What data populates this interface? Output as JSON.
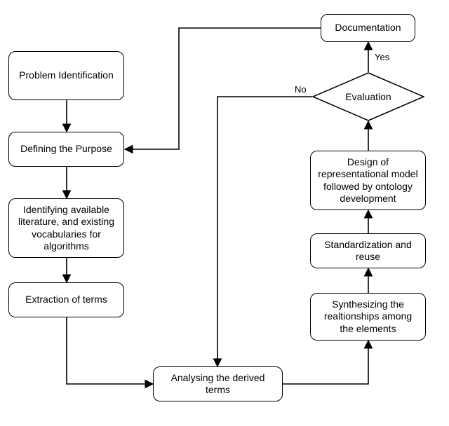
{
  "chart_data": {
    "type": "flowchart",
    "nodes": [
      {
        "id": "problem",
        "label": "Problem Identification",
        "kind": "process"
      },
      {
        "id": "purpose",
        "label": "Defining the Purpose",
        "kind": "process"
      },
      {
        "id": "literature",
        "label": "Identifying available literature, and existing vocabularies for algorithms",
        "kind": "process"
      },
      {
        "id": "extract",
        "label": "Extraction of terms",
        "kind": "process"
      },
      {
        "id": "analyse",
        "label": "Analysing the derived terms",
        "kind": "process"
      },
      {
        "id": "synth",
        "label": "Synthesizing the realtionships among the elements",
        "kind": "process"
      },
      {
        "id": "standard",
        "label": "Standardization and reuse",
        "kind": "process"
      },
      {
        "id": "design",
        "label": "Design of representational model followed by ontology development",
        "kind": "process"
      },
      {
        "id": "eval",
        "label": "Evaluation",
        "kind": "decision"
      },
      {
        "id": "doc",
        "label": "Documentation",
        "kind": "process"
      }
    ],
    "edges": [
      {
        "from": "problem",
        "to": "purpose"
      },
      {
        "from": "purpose",
        "to": "literature"
      },
      {
        "from": "literature",
        "to": "extract"
      },
      {
        "from": "extract",
        "to": "analyse"
      },
      {
        "from": "analyse",
        "to": "synth"
      },
      {
        "from": "synth",
        "to": "standard"
      },
      {
        "from": "standard",
        "to": "design"
      },
      {
        "from": "design",
        "to": "eval"
      },
      {
        "from": "eval",
        "to": "doc",
        "label": "Yes"
      },
      {
        "from": "eval",
        "to": "analyse",
        "label": "No"
      },
      {
        "from": "doc",
        "to": "purpose"
      }
    ]
  },
  "nodes": {
    "problem": {
      "label": "Problem Identification"
    },
    "purpose": {
      "label": "Defining the Purpose"
    },
    "literature": {
      "label": "Identifying available literature, and existing vocabularies for algorithms"
    },
    "extract": {
      "label": "Extraction of terms"
    },
    "analyse": {
      "label": "Analysing the derived terms"
    },
    "synth": {
      "label": "Synthesizing the realtionships among the elements"
    },
    "standard": {
      "label": "Standardization and reuse"
    },
    "design": {
      "label": "Design of representational model followed by ontology development"
    },
    "eval": {
      "label": "Evaluation"
    },
    "doc": {
      "label": "Documentation"
    }
  },
  "edge_labels": {
    "yes": "Yes",
    "no": "No"
  }
}
